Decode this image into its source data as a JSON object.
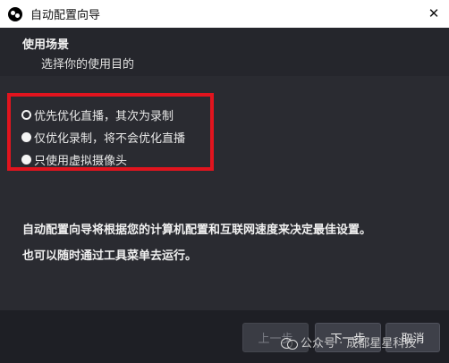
{
  "window": {
    "title": "自动配置向导",
    "close_glyph": "✕"
  },
  "header": {
    "title": "使用场景",
    "subtitle": "选择你的使用目的"
  },
  "options": [
    {
      "label": "优先优化直播，其次为录制",
      "checked": true
    },
    {
      "label": "仅优化录制，将不会优化直播",
      "checked": false
    },
    {
      "label": "只使用虚拟摄像头",
      "checked": false
    }
  ],
  "description": {
    "line1": "自动配置向导将根据您的计算机配置和互联网速度来决定最佳设置。",
    "line2": "也可以随时通过工具菜单去运行。"
  },
  "buttons": {
    "prev": "上一步",
    "next": "下一步",
    "cancel": "取消"
  },
  "watermark": {
    "text": "公众号 · 成都星星科技"
  },
  "colors": {
    "highlight_border": "#e1141e",
    "background": "#2a2b31",
    "titlebar": "#ffffff"
  }
}
